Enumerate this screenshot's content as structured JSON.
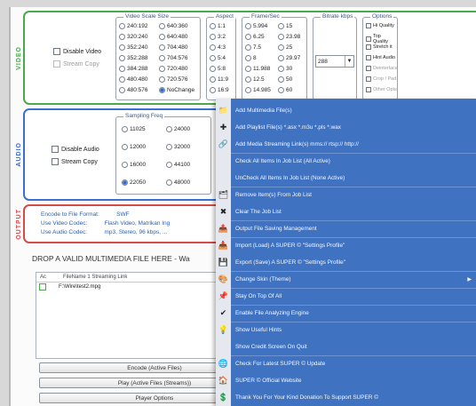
{
  "video": {
    "section_label": "VIDEO",
    "disable_label": "Disable Video",
    "stream_copy_label": "Stream Copy",
    "scale_legend": "Video Scale Size",
    "scales_col1": [
      "240:192",
      "320:240",
      "352:240",
      "352:288",
      "384:288",
      "480:480",
      "480:576"
    ],
    "scales_col2": [
      "640:360",
      "640:480",
      "704:480",
      "704:576",
      "720:480",
      "720:576",
      "NoChange"
    ],
    "aspect_legend": "Aspect",
    "aspects": [
      "1:1",
      "3:2",
      "4:3",
      "5:4",
      "5:8",
      "11:9",
      "16:9"
    ],
    "fps_legend": "Frame/Sec",
    "fps_col1": [
      "5.994",
      "6.25",
      "7.5",
      "8",
      "11.988",
      "12.5",
      "14.985"
    ],
    "fps_col2": [
      "15",
      "23.98",
      "25",
      "29.97",
      "30",
      "50",
      "60"
    ],
    "bitrate_legend": "Bitrate  kbps",
    "bitrate_value": "288",
    "options_legend": "Options",
    "options": [
      "Hi Quality",
      "Top Quality",
      "Stretch it",
      "Hint Audio",
      "Deinterlace",
      "Crop / Pad",
      "Other Opts"
    ]
  },
  "audio": {
    "section_label": "AUDIO",
    "disable_label": "Disable Audio",
    "stream_copy_label": "Stream Copy",
    "freq_legend": "Sampling Freq",
    "freq_col1": [
      "11025",
      "12000",
      "16000",
      "22050"
    ],
    "freq_col2": [
      "24000",
      "32000",
      "44100",
      "48000"
    ]
  },
  "output": {
    "section_label": "OUTPUT",
    "encode_format_label": "Encode to File Format:",
    "encode_format_value": "SWF",
    "video_codec_label": "Use Video Codec:",
    "video_codec_value": "Flash Video, Matrikan Ing",
    "audio_codec_label": "Use Audio Codec:",
    "audio_codec_value": "mp3, Stereo, 96 kbps, ..."
  },
  "drop_hint": "DROP A VALID MULTIMEDIA FILE HERE - Wa",
  "file_table": {
    "headers": [
      "Ac",
      "FileName  1  Streaming Link"
    ],
    "rows": [
      {
        "name": "F:\\Wire\\test2.mpg"
      }
    ]
  },
  "buttons": {
    "encode": "Encode (Active Files)",
    "play": "Play (Active Files (Streams))",
    "player_options": "Player Options"
  },
  "context_menu": [
    {
      "label": "Add Multimedia File(s)",
      "icon": "folder-icon",
      "icon_glyph": "📁"
    },
    {
      "label": "Add Playlist File(s)   *.asx  *.m3u  *.pls  *.wax",
      "icon": "plus-icon",
      "icon_glyph": "✚"
    },
    {
      "label": "Add Media Streaming Link(s)   mms://  rtsp://  http://",
      "icon": "link-icon",
      "icon_glyph": "🔗"
    },
    {
      "label": "Check All Items In Job List (All Active)",
      "icon": "",
      "icon_glyph": ""
    },
    {
      "label": "UnCheck All Items In Job List (None Active)",
      "icon": "",
      "icon_glyph": ""
    },
    {
      "label": "Remove Item(s) From Job List",
      "icon": "remove-icon",
      "icon_glyph": "🗂"
    },
    {
      "label": "Clear The Job List",
      "icon": "clear-icon",
      "icon_glyph": "✖"
    },
    {
      "label": "Output File Saving Management",
      "icon": "output-icon",
      "icon_glyph": "📤"
    },
    {
      "label": "Import (Load) A SUPER © \"Settings Profile\"",
      "icon": "import-icon",
      "icon_glyph": "📥"
    },
    {
      "label": "Export (Save) A SUPER © \"Settings Profile\"",
      "icon": "export-icon",
      "icon_glyph": "💾"
    },
    {
      "label": "Change Skin (Theme)",
      "icon": "skin-icon",
      "icon_glyph": "🎨"
    },
    {
      "label": "Stay On Top Of All",
      "icon": "pin-icon",
      "icon_glyph": "📌"
    },
    {
      "label": "Enable File Analyzing Engine",
      "icon": "check-icon",
      "icon_glyph": "✔"
    },
    {
      "label": "Show Useful Hints",
      "icon": "hint-icon",
      "icon_glyph": "💡"
    },
    {
      "label": "Show Credit Screen On Quit",
      "icon": "",
      "icon_glyph": ""
    },
    {
      "label": "Check For Latest SUPER © Update",
      "icon": "update-icon",
      "icon_glyph": "🌐"
    },
    {
      "label": "SUPER © Official Website",
      "icon": "web-icon",
      "icon_glyph": "🏠"
    },
    {
      "label": "Thank You For Your Kind Donation To Support SUPER ©",
      "icon": "donate-icon",
      "icon_glyph": "💲"
    }
  ],
  "colors": {
    "menu_bg": "#3f73c2",
    "video_border": "#4aa94a",
    "audio_border": "#3b6fd1",
    "output_border": "#d64a4a"
  }
}
